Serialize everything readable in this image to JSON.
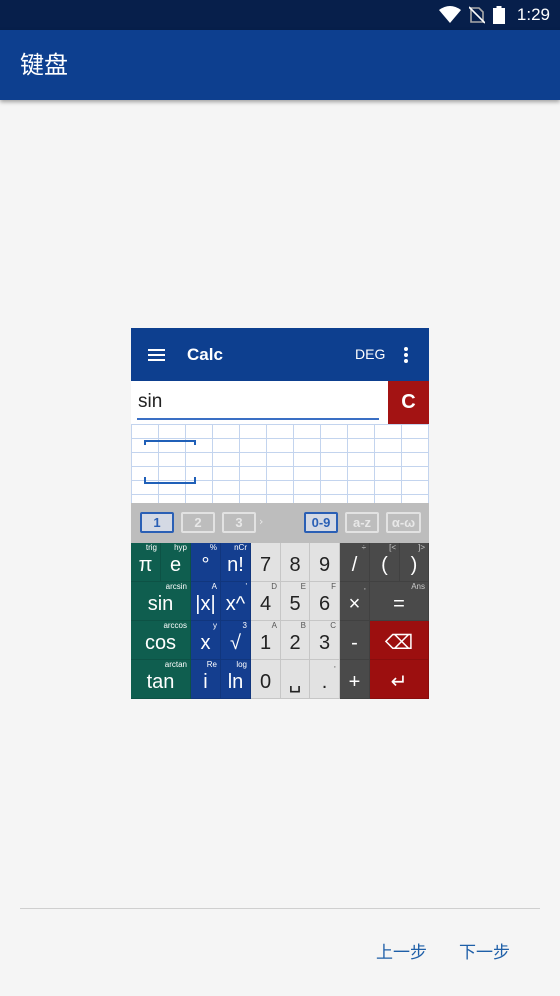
{
  "status_bar": {
    "time": "1:29",
    "icons": [
      "wifi-icon",
      "no-sim-icon",
      "battery-icon"
    ]
  },
  "app_bar": {
    "title": "键盘"
  },
  "preview": {
    "app_title": "Calc",
    "angle_mode": "DEG",
    "input_value": "sin",
    "clear_label": "C",
    "tabs": [
      "1",
      "2",
      "3",
      "0-9",
      "a-z",
      "α-ω"
    ],
    "tab_more": "›",
    "keys": [
      {
        "main": "π",
        "sup": "trig"
      },
      {
        "main": "e",
        "sup": "hyp"
      },
      {
        "main": "°",
        "sup": "%"
      },
      {
        "main": "n!",
        "sup": "nCr"
      },
      {
        "main": "7",
        "sup": ""
      },
      {
        "main": "8",
        "sup": ""
      },
      {
        "main": "9",
        "sup": ""
      },
      {
        "main": "/",
        "sup": "÷"
      },
      {
        "main": "(",
        "sup": "[<"
      },
      {
        "main": ")",
        "sup": "]>"
      },
      {
        "main": "sin",
        "sup": "arcsin"
      },
      {
        "main": "|x|",
        "sup": "A"
      },
      {
        "main": "x^",
        "sup": "'"
      },
      {
        "main": "4",
        "sup": "D"
      },
      {
        "main": "5",
        "sup": "E"
      },
      {
        "main": "6",
        "sup": "F"
      },
      {
        "main": "×",
        "sup": ","
      },
      {
        "main": "=",
        "sup": "Ans"
      },
      {
        "main": "cos",
        "sup": "arccos"
      },
      {
        "main": "x",
        "sup": "y"
      },
      {
        "main": "√",
        "sup": "3"
      },
      {
        "main": "1",
        "sup": "A"
      },
      {
        "main": "2",
        "sup": "B"
      },
      {
        "main": "3",
        "sup": "C"
      },
      {
        "main": "-",
        "sup": ""
      },
      {
        "main": "⌫",
        "sup": ""
      },
      {
        "main": "tan",
        "sup": "arctan"
      },
      {
        "main": "i",
        "sup": "Re"
      },
      {
        "main": "ln",
        "sup": "log"
      },
      {
        "main": "0",
        "sup": ""
      },
      {
        "main": "␣",
        "sup": ""
      },
      {
        "main": ".",
        "sup": ","
      },
      {
        "main": "+",
        "sup": ""
      },
      {
        "main": "↵",
        "sup": ""
      }
    ]
  },
  "footer": {
    "prev_label": "上一步",
    "next_label": "下一步"
  },
  "colors": {
    "status_bar": "#071f4b",
    "app_bar": "#0d3f8f",
    "accent": "#1e5fa8",
    "clear_button": "#a31313"
  }
}
